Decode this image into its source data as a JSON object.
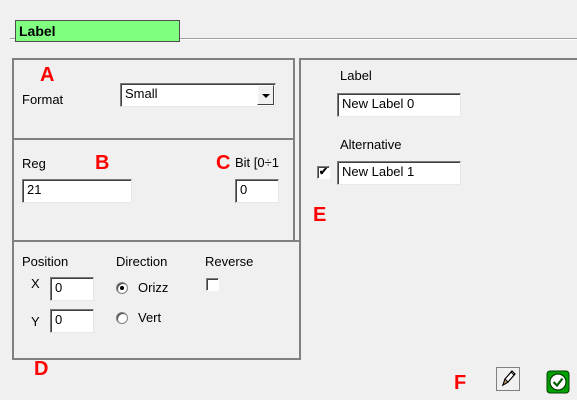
{
  "title": "Label",
  "markers": {
    "a": "A",
    "b": "B",
    "c": "C",
    "d": "D",
    "e": "E",
    "f": "F"
  },
  "format": {
    "label": "Format",
    "value": "Small"
  },
  "reg": {
    "label": "Reg",
    "value": "21"
  },
  "bit": {
    "label": "Bit [0÷1",
    "value": "0"
  },
  "label_field": {
    "label": "Label",
    "value": "New Label 0"
  },
  "alternative": {
    "label": "Alternative",
    "value": "New Label 1",
    "checked": true,
    "check_glyph": "✔"
  },
  "position": {
    "label": "Position",
    "x_label": "X",
    "x_value": "0",
    "y_label": "Y",
    "y_value": "0"
  },
  "direction": {
    "label": "Direction",
    "options": [
      "Orizz",
      "Vert"
    ],
    "selected": "Orizz"
  },
  "reverse": {
    "label": "Reverse",
    "checked": false
  },
  "toolbar": {
    "edit_icon": "pencil-icon",
    "ok_icon": "checkmark-icon"
  },
  "colors": {
    "title_bg": "#80ff80",
    "marker": "#ff0000",
    "ok_green": "#00a000"
  }
}
